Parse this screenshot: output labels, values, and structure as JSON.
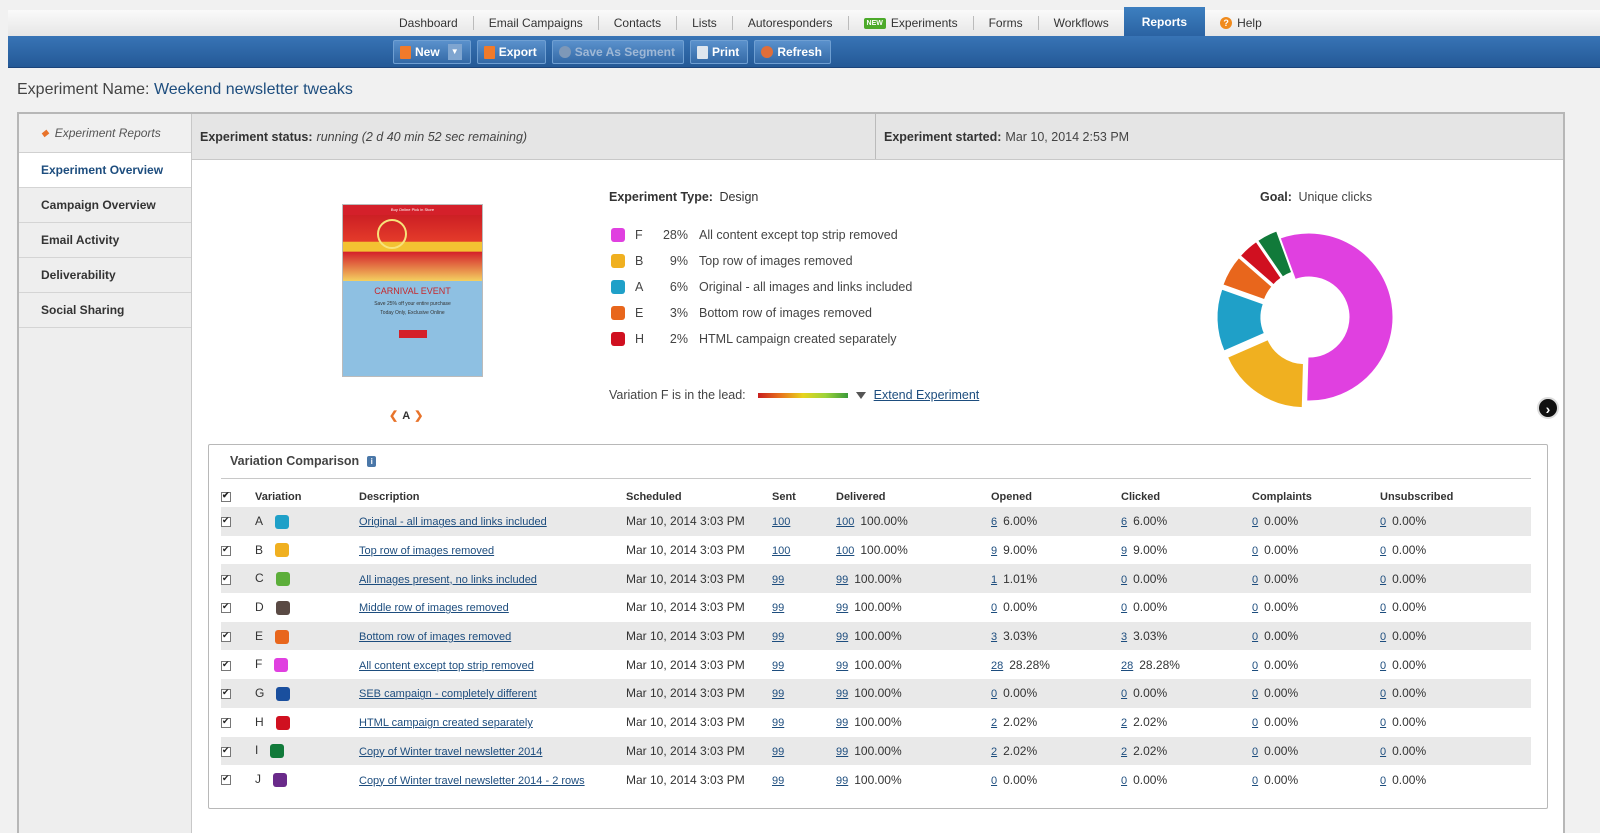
{
  "nav": {
    "items": [
      "Dashboard",
      "Email Campaigns",
      "Contacts",
      "Lists",
      "Autoresponders",
      "Experiments",
      "Forms",
      "Workflows",
      "Reports",
      "Help"
    ],
    "new_badge": "NEW",
    "active": "Reports"
  },
  "toolbar": {
    "new_label": "New",
    "export_label": "Export",
    "save_segment_label": "Save As Segment",
    "print_label": "Print",
    "refresh_label": "Refresh"
  },
  "experiment": {
    "name_label": "Experiment Name:",
    "name": "Weekend newsletter tweaks",
    "status_label": "Experiment status:",
    "status": "running (2 d 40 min 52 sec remaining)",
    "started_label": "Experiment started:",
    "started": "Mar 10, 2014 2:53 PM",
    "type_label": "Experiment Type:",
    "type": "Design",
    "goal_label": "Goal:",
    "goal": "Unique clicks",
    "lead_text": "Variation F is in the lead:",
    "extend_label": "Extend Experiment"
  },
  "sidebar": {
    "back_label": "Experiment Reports",
    "items": [
      "Experiment Overview",
      "Campaign Overview",
      "Email Activity",
      "Deliverability",
      "Social Sharing"
    ]
  },
  "preview": {
    "top_strip": "Buy Online Pick in Store",
    "title": "CARNIVAL EVENT",
    "line1": "Save 25% off your entire purchase",
    "line2": "Today Only, Exclusive Online",
    "variation_label": "A"
  },
  "legend": [
    {
      "letter": "F",
      "pct": "28%",
      "desc": "All content except top strip removed",
      "color": "#e040e0"
    },
    {
      "letter": "B",
      "pct": "9%",
      "desc": "Top row of images removed",
      "color": "#f0b020"
    },
    {
      "letter": "A",
      "pct": "6%",
      "desc": "Original - all images and links included",
      "color": "#1fa0c8"
    },
    {
      "letter": "E",
      "pct": "3%",
      "desc": "Bottom row of images removed",
      "color": "#e8661c"
    },
    {
      "letter": "H",
      "pct": "2%",
      "desc": "HTML campaign created separately",
      "color": "#d01020"
    }
  ],
  "chart_data": {
    "type": "pie",
    "categories": [
      "F",
      "B",
      "A",
      "E",
      "H",
      "I"
    ],
    "values": [
      28,
      9,
      6,
      3,
      2,
      2
    ],
    "colors": [
      "#e040e0",
      "#f0b020",
      "#1fa0c8",
      "#e8661c",
      "#d01020",
      "#117a3a"
    ]
  },
  "comparison": {
    "title": "Variation Comparison",
    "headers": [
      "Variation",
      "Description",
      "Scheduled",
      "Sent",
      "Delivered",
      "Opened",
      "Clicked",
      "Complaints",
      "Unsubscribed"
    ],
    "rows": [
      {
        "v": "A",
        "color": "#1fa0c8",
        "desc": "Original - all images and links included",
        "sched": "Mar 10, 2014 3:03 PM",
        "sent": "100",
        "deliv": "100",
        "deliv_pct": "100.00%",
        "open": "6",
        "open_pct": "6.00%",
        "click": "6",
        "click_pct": "6.00%",
        "comp": "0",
        "comp_pct": "0.00%",
        "unsub": "0",
        "unsub_pct": "0.00%"
      },
      {
        "v": "B",
        "color": "#f0b020",
        "desc": "Top row of images removed",
        "sched": "Mar 10, 2014 3:03 PM",
        "sent": "100",
        "deliv": "100",
        "deliv_pct": "100.00%",
        "open": "9",
        "open_pct": "9.00%",
        "click": "9",
        "click_pct": "9.00%",
        "comp": "0",
        "comp_pct": "0.00%",
        "unsub": "0",
        "unsub_pct": "0.00%"
      },
      {
        "v": "C",
        "color": "#5cae3a",
        "desc": "All images present, no links included",
        "sched": "Mar 10, 2014 3:03 PM",
        "sent": "99",
        "deliv": "99",
        "deliv_pct": "100.00%",
        "open": "1",
        "open_pct": "1.01%",
        "click": "0",
        "click_pct": "0.00%",
        "comp": "0",
        "comp_pct": "0.00%",
        "unsub": "0",
        "unsub_pct": "0.00%"
      },
      {
        "v": "D",
        "color": "#5a4a44",
        "desc": "Middle row of images removed",
        "sched": "Mar 10, 2014 3:03 PM",
        "sent": "99",
        "deliv": "99",
        "deliv_pct": "100.00%",
        "open": "0",
        "open_pct": "0.00%",
        "click": "0",
        "click_pct": "0.00%",
        "comp": "0",
        "comp_pct": "0.00%",
        "unsub": "0",
        "unsub_pct": "0.00%"
      },
      {
        "v": "E",
        "color": "#e8661c",
        "desc": "Bottom row of images removed",
        "sched": "Mar 10, 2014 3:03 PM",
        "sent": "99",
        "deliv": "99",
        "deliv_pct": "100.00%",
        "open": "3",
        "open_pct": "3.03%",
        "click": "3",
        "click_pct": "3.03%",
        "comp": "0",
        "comp_pct": "0.00%",
        "unsub": "0",
        "unsub_pct": "0.00%"
      },
      {
        "v": "F",
        "color": "#e040e0",
        "desc": "All content except top strip removed",
        "sched": "Mar 10, 2014 3:03 PM",
        "sent": "99",
        "deliv": "99",
        "deliv_pct": "100.00%",
        "open": "28",
        "open_pct": "28.28%",
        "click": "28",
        "click_pct": "28.28%",
        "comp": "0",
        "comp_pct": "0.00%",
        "unsub": "0",
        "unsub_pct": "0.00%"
      },
      {
        "v": "G",
        "color": "#1a4f9e",
        "desc": "SEB campaign - completely different",
        "sched": "Mar 10, 2014 3:03 PM",
        "sent": "99",
        "deliv": "99",
        "deliv_pct": "100.00%",
        "open": "0",
        "open_pct": "0.00%",
        "click": "0",
        "click_pct": "0.00%",
        "comp": "0",
        "comp_pct": "0.00%",
        "unsub": "0",
        "unsub_pct": "0.00%"
      },
      {
        "v": "H",
        "color": "#d01020",
        "desc": "HTML campaign created separately",
        "sched": "Mar 10, 2014 3:03 PM",
        "sent": "99",
        "deliv": "99",
        "deliv_pct": "100.00%",
        "open": "2",
        "open_pct": "2.02%",
        "click": "2",
        "click_pct": "2.02%",
        "comp": "0",
        "comp_pct": "0.00%",
        "unsub": "0",
        "unsub_pct": "0.00%"
      },
      {
        "v": "I",
        "color": "#117a3a",
        "desc": "Copy of Winter travel newsletter 2014",
        "sched": "Mar 10, 2014 3:03 PM",
        "sent": "99",
        "deliv": "99",
        "deliv_pct": "100.00%",
        "open": "2",
        "open_pct": "2.02%",
        "click": "2",
        "click_pct": "2.02%",
        "comp": "0",
        "comp_pct": "0.00%",
        "unsub": "0",
        "unsub_pct": "0.00%"
      },
      {
        "v": "J",
        "color": "#6a2a8a",
        "desc": "Copy of Winter travel newsletter 2014 - 2 rows",
        "sched": "Mar 10, 2014 3:03 PM",
        "sent": "99",
        "deliv": "99",
        "deliv_pct": "100.00%",
        "open": "0",
        "open_pct": "0.00%",
        "click": "0",
        "click_pct": "0.00%",
        "comp": "0",
        "comp_pct": "0.00%",
        "unsub": "0",
        "unsub_pct": "0.00%"
      }
    ]
  }
}
